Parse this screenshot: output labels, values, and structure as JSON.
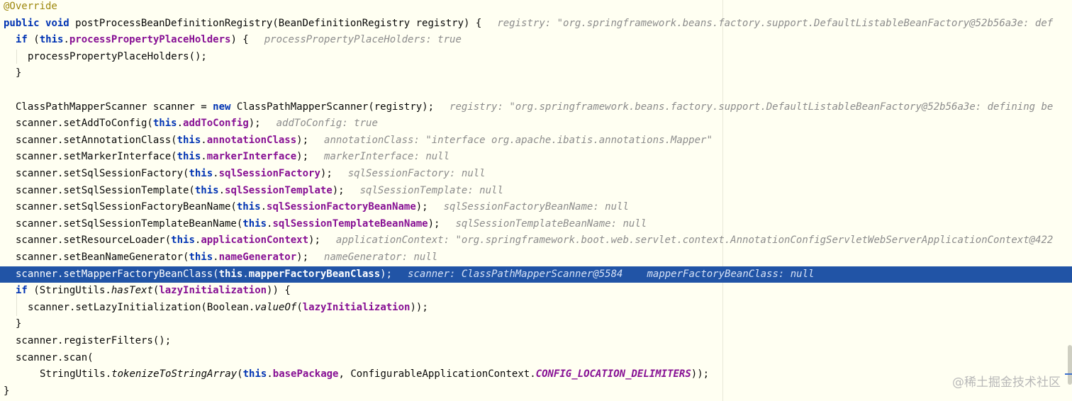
{
  "editor": {
    "lines": [
      {
        "indent": 0,
        "tokens": [
          {
            "t": "@Override",
            "k": "ann"
          }
        ],
        "hints": []
      },
      {
        "indent": 0,
        "tokens": [
          {
            "t": "public",
            "k": "kw"
          },
          {
            "t": " "
          },
          {
            "t": "void",
            "k": "kw"
          },
          {
            "t": " postProcessBeanDefinitionRegistry(BeanDefinitionRegistry registry) {"
          }
        ],
        "hints": [
          "registry: \"org.springframework.beans.factory.support.DefaultListableBeanFactory@52b56a3e: def"
        ]
      },
      {
        "indent": 1,
        "tokens": [
          {
            "t": "if",
            "k": "kw"
          },
          {
            "t": " ("
          },
          {
            "t": "this",
            "k": "kw"
          },
          {
            "t": "."
          },
          {
            "t": "processPropertyPlaceHolders",
            "k": "field"
          },
          {
            "t": ") {"
          }
        ],
        "hints": [
          "processPropertyPlaceHolders: true"
        ]
      },
      {
        "indent": 2,
        "tokens": [
          {
            "t": "processPropertyPlaceHolders();"
          }
        ],
        "hints": []
      },
      {
        "indent": 1,
        "tokens": [
          {
            "t": "}"
          }
        ],
        "hints": []
      },
      {
        "indent": 0,
        "tokens": [],
        "hints": []
      },
      {
        "indent": 1,
        "tokens": [
          {
            "t": "ClassPathMapperScanner scanner = "
          },
          {
            "t": "new",
            "k": "kw"
          },
          {
            "t": " ClassPathMapperScanner(registry);"
          }
        ],
        "hints": [
          "registry: \"org.springframework.beans.factory.support.DefaultListableBeanFactory@52b56a3e: defining be"
        ]
      },
      {
        "indent": 1,
        "tokens": [
          {
            "t": "scanner.setAddToConfig("
          },
          {
            "t": "this",
            "k": "kw"
          },
          {
            "t": "."
          },
          {
            "t": "addToConfig",
            "k": "field"
          },
          {
            "t": ");"
          }
        ],
        "hints": [
          "addToConfig: true"
        ]
      },
      {
        "indent": 1,
        "tokens": [
          {
            "t": "scanner.setAnnotationClass("
          },
          {
            "t": "this",
            "k": "kw"
          },
          {
            "t": "."
          },
          {
            "t": "annotationClass",
            "k": "field"
          },
          {
            "t": ");"
          }
        ],
        "hints": [
          "annotationClass: \"interface org.apache.ibatis.annotations.Mapper\""
        ]
      },
      {
        "indent": 1,
        "tokens": [
          {
            "t": "scanner.setMarkerInterface("
          },
          {
            "t": "this",
            "k": "kw"
          },
          {
            "t": "."
          },
          {
            "t": "markerInterface",
            "k": "field"
          },
          {
            "t": ");"
          }
        ],
        "hints": [
          "markerInterface: null"
        ]
      },
      {
        "indent": 1,
        "tokens": [
          {
            "t": "scanner.setSqlSessionFactory("
          },
          {
            "t": "this",
            "k": "kw"
          },
          {
            "t": "."
          },
          {
            "t": "sqlSessionFactory",
            "k": "field"
          },
          {
            "t": ");"
          }
        ],
        "hints": [
          "sqlSessionFactory: null"
        ]
      },
      {
        "indent": 1,
        "tokens": [
          {
            "t": "scanner.setSqlSessionTemplate("
          },
          {
            "t": "this",
            "k": "kw"
          },
          {
            "t": "."
          },
          {
            "t": "sqlSessionTemplate",
            "k": "field"
          },
          {
            "t": ");"
          }
        ],
        "hints": [
          "sqlSessionTemplate: null"
        ]
      },
      {
        "indent": 1,
        "tokens": [
          {
            "t": "scanner.setSqlSessionFactoryBeanName("
          },
          {
            "t": "this",
            "k": "kw"
          },
          {
            "t": "."
          },
          {
            "t": "sqlSessionFactoryBeanName",
            "k": "field"
          },
          {
            "t": ");"
          }
        ],
        "hints": [
          "sqlSessionFactoryBeanName: null"
        ]
      },
      {
        "indent": 1,
        "tokens": [
          {
            "t": "scanner.setSqlSessionTemplateBeanName("
          },
          {
            "t": "this",
            "k": "kw"
          },
          {
            "t": "."
          },
          {
            "t": "sqlSessionTemplateBeanName",
            "k": "field"
          },
          {
            "t": ");"
          }
        ],
        "hints": [
          "sqlSessionTemplateBeanName: null"
        ]
      },
      {
        "indent": 1,
        "tokens": [
          {
            "t": "scanner.setResourceLoader("
          },
          {
            "t": "this",
            "k": "kw"
          },
          {
            "t": "."
          },
          {
            "t": "applicationContext",
            "k": "field"
          },
          {
            "t": ");"
          }
        ],
        "hints": [
          "applicationContext: \"org.springframework.boot.web.servlet.context.AnnotationConfigServletWebServerApplicationContext@422"
        ]
      },
      {
        "indent": 1,
        "tokens": [
          {
            "t": "scanner.setBeanNameGenerator("
          },
          {
            "t": "this",
            "k": "kw"
          },
          {
            "t": "."
          },
          {
            "t": "nameGenerator",
            "k": "field"
          },
          {
            "t": ");"
          }
        ],
        "hints": [
          "nameGenerator: null"
        ]
      },
      {
        "indent": 1,
        "highlighted": true,
        "tokens": [
          {
            "t": "scanner.setMapperFactoryBeanClass("
          },
          {
            "t": "this",
            "k": "kw"
          },
          {
            "t": "."
          },
          {
            "t": "mapperFactoryBeanClass",
            "k": "field"
          },
          {
            "t": ");"
          }
        ],
        "hints": [
          "scanner: ClassPathMapperScanner@5584",
          "mapperFactoryBeanClass: null"
        ]
      },
      {
        "indent": 1,
        "tokens": [
          {
            "t": "if",
            "k": "kw"
          },
          {
            "t": " (StringUtils."
          },
          {
            "t": "hasText",
            "k": "italic"
          },
          {
            "t": "("
          },
          {
            "t": "lazyInitialization",
            "k": "field"
          },
          {
            "t": ")) {"
          }
        ],
        "hints": []
      },
      {
        "indent": 2,
        "tokens": [
          {
            "t": "scanner.setLazyInitialization(Boolean."
          },
          {
            "t": "valueOf",
            "k": "italic"
          },
          {
            "t": "("
          },
          {
            "t": "lazyInitialization",
            "k": "field"
          },
          {
            "t": "));"
          }
        ],
        "hints": []
      },
      {
        "indent": 1,
        "tokens": [
          {
            "t": "}"
          }
        ],
        "hints": []
      },
      {
        "indent": 1,
        "tokens": [
          {
            "t": "scanner.registerFilters();"
          }
        ],
        "hints": []
      },
      {
        "indent": 1,
        "tokens": [
          {
            "t": "scanner.scan("
          }
        ],
        "hints": []
      },
      {
        "indent": 3,
        "tokens": [
          {
            "t": "StringUtils."
          },
          {
            "t": "tokenizeToStringArray",
            "k": "italic"
          },
          {
            "t": "("
          },
          {
            "t": "this",
            "k": "kw"
          },
          {
            "t": "."
          },
          {
            "t": "basePackage",
            "k": "field"
          },
          {
            "t": ", ConfigurableApplicationContext."
          },
          {
            "t": "CONFIG_LOCATION_DELIMITERS",
            "k": "const"
          },
          {
            "t": "));"
          }
        ],
        "hints": []
      },
      {
        "indent": 0,
        "tokens": [
          {
            "t": "}"
          }
        ],
        "hints": []
      }
    ]
  },
  "watermark": "@稀土掘金技术社区",
  "colors": {
    "background": "#FFFFF2",
    "highlight": "#2154A6",
    "keyword": "#0033B3",
    "field": "#871094",
    "annotation": "#9E880D",
    "hint": "#8C8C8C"
  }
}
